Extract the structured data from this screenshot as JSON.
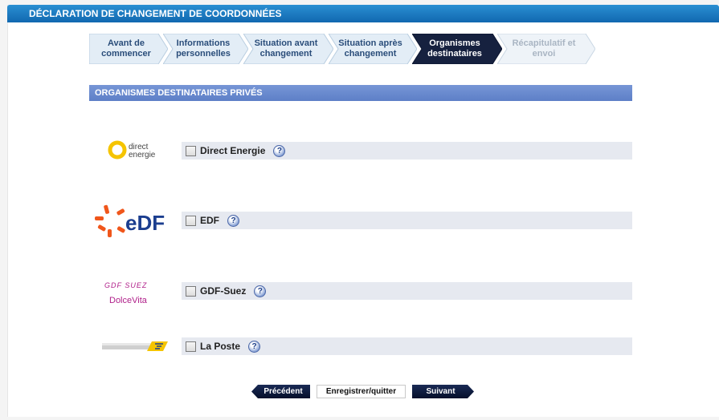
{
  "header": {
    "title": "DÉCLARATION DE CHANGEMENT DE COORDONNÉES"
  },
  "steps": [
    {
      "line1": "Avant de",
      "line2": "commencer",
      "state": "done"
    },
    {
      "line1": "Informations",
      "line2": "personnelles",
      "state": "done"
    },
    {
      "line1": "Situation avant",
      "line2": "changement",
      "state": "done"
    },
    {
      "line1": "Situation après",
      "line2": "changement",
      "state": "done"
    },
    {
      "line1": "Organismes",
      "line2": "destinataires",
      "state": "active"
    },
    {
      "line1": "Récapitulatif et",
      "line2": "envoi",
      "state": "future"
    }
  ],
  "section": {
    "title": "ORGANISMES DESTINATAIRES PRIVÉS"
  },
  "organisms": [
    {
      "label": "Direct Energie",
      "logo_line1": "direct",
      "logo_line2": "energie",
      "help": "?"
    },
    {
      "label": "EDF",
      "logo_text": "eDF",
      "help": "?"
    },
    {
      "label": "GDF-Suez",
      "logo_line1": "GDF SUEZ",
      "logo_line2": "DolceVita",
      "help": "?"
    },
    {
      "label": "La Poste",
      "help": "?"
    }
  ],
  "buttons": {
    "previous": "Précédent",
    "save_quit": "Enregistrer/quitter",
    "next": "Suivant"
  },
  "colors": {
    "titlebar": "#1a7cc4",
    "step_active": "#16213f",
    "section_header": "#6788cf",
    "row_bg": "#e6e9f0",
    "edf_orange": "#f0561b",
    "edf_blue": "#1b3e8f"
  }
}
